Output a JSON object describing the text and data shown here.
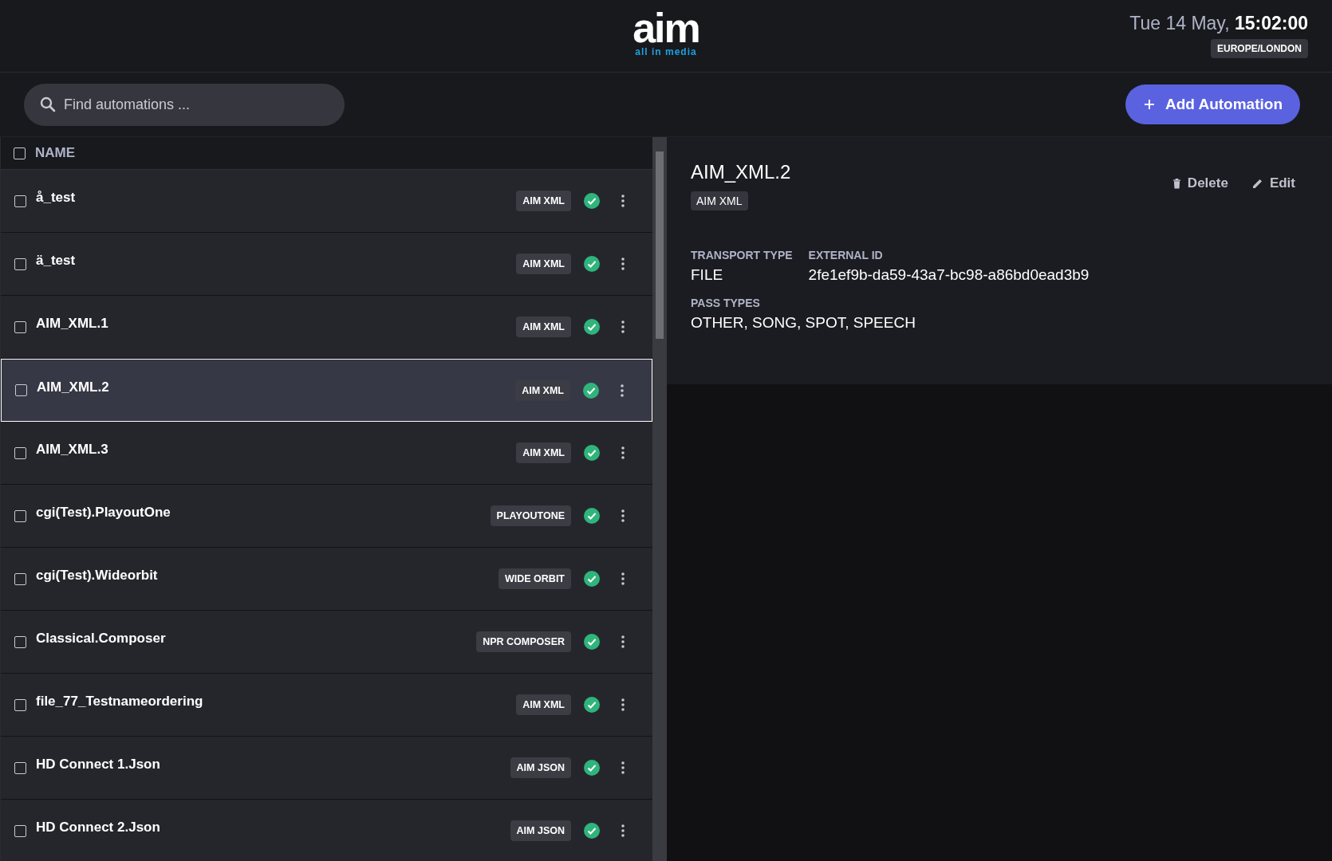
{
  "logo": {
    "wordmark": "aim",
    "tagline": "all in media"
  },
  "clock": {
    "date": "Tue 14 May,",
    "time": "15:02:00",
    "timezone": "EUROPE/LONDON"
  },
  "search": {
    "placeholder": "Find automations ..."
  },
  "add_button": {
    "label": "Add Automation"
  },
  "list": {
    "header": {
      "label": "NAME",
      "checked": false
    },
    "rows": [
      {
        "name": "å_test",
        "tag": "AIM XML",
        "healthy": true,
        "checked": false,
        "selected": false
      },
      {
        "name": "ä_test",
        "tag": "AIM XML",
        "healthy": true,
        "checked": false,
        "selected": false
      },
      {
        "name": "AIM_XML.1",
        "tag": "AIM XML",
        "healthy": true,
        "checked": false,
        "selected": false
      },
      {
        "name": "AIM_XML.2",
        "tag": "AIM XML",
        "healthy": true,
        "checked": false,
        "selected": true
      },
      {
        "name": "AIM_XML.3",
        "tag": "AIM XML",
        "healthy": true,
        "checked": false,
        "selected": false
      },
      {
        "name": "cgi(Test).PlayoutOne",
        "tag": "PLAYOUTONE",
        "healthy": true,
        "checked": false,
        "selected": false
      },
      {
        "name": "cgi(Test).Wideorbit",
        "tag": "WIDE ORBIT",
        "healthy": true,
        "checked": false,
        "selected": false
      },
      {
        "name": "Classical.Composer",
        "tag": "NPR COMPOSER",
        "healthy": true,
        "checked": false,
        "selected": false
      },
      {
        "name": "file_77_Testnameordering",
        "tag": "AIM XML",
        "healthy": true,
        "checked": false,
        "selected": false
      },
      {
        "name": "HD Connect 1.Json",
        "tag": "AIM JSON",
        "healthy": true,
        "checked": false,
        "selected": false
      },
      {
        "name": "HD Connect 2.Json",
        "tag": "AIM JSON",
        "healthy": true,
        "checked": false,
        "selected": false
      }
    ]
  },
  "detail": {
    "title": "AIM_XML.2",
    "tag": "AIM XML",
    "actions": [
      {
        "kind": "delete",
        "label": "Delete"
      },
      {
        "kind": "edit",
        "label": "Edit"
      }
    ],
    "fields": [
      {
        "label": "TRANSPORT TYPE",
        "value": "FILE"
      },
      {
        "label": "EXTERNAL ID",
        "value": "2fe1ef9b-da59-43a7-bc98-a86bd0ead3b9"
      }
    ],
    "pass_types": {
      "label": "PASS TYPES",
      "value": "OTHER, SONG, SPOT, SPEECH"
    }
  }
}
